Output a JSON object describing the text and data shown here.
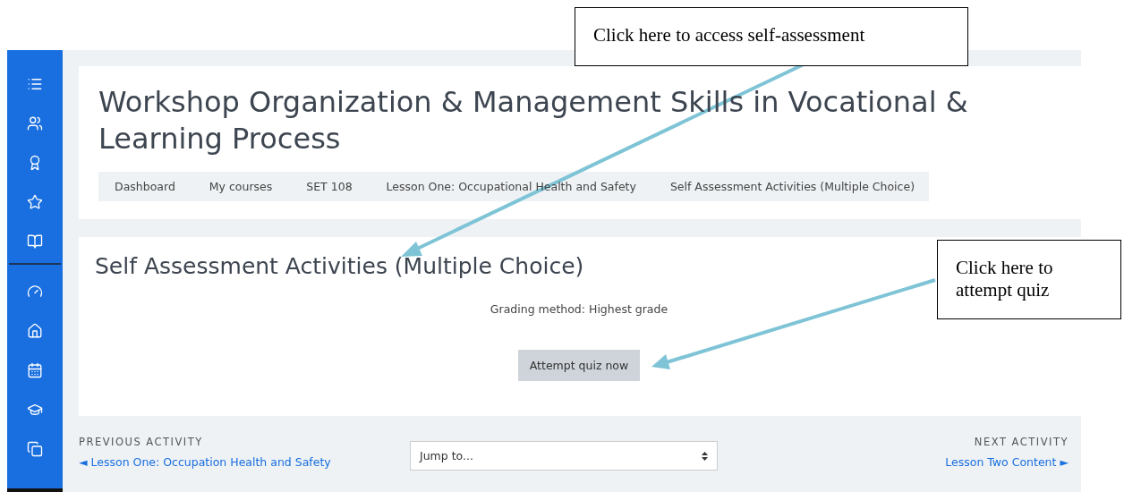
{
  "course": {
    "title": "Workshop Organization & Management Skills in Vocational & Learning Process"
  },
  "breadcrumb": [
    "Dashboard",
    "My courses",
    "SET 108",
    "Lesson One: Occupational Health and Safety",
    "Self Assessment Activities (Multiple Choice)"
  ],
  "activity": {
    "title": "Self Assessment Activities (Multiple Choice)",
    "grading": "Grading method: Highest grade",
    "button": "Attempt quiz now"
  },
  "navigation": {
    "previous_label": "PREVIOUS ACTIVITY",
    "previous_link": "◄ Lesson One: Occupation Health and Safety",
    "jump_placeholder": "Jump to...",
    "next_label": "NEXT ACTIVITY",
    "next_link": "Lesson Two Content ►"
  },
  "callouts": [
    {
      "text": "Click here to access self-assessment"
    },
    {
      "text": "Click here to attempt quiz"
    }
  ]
}
